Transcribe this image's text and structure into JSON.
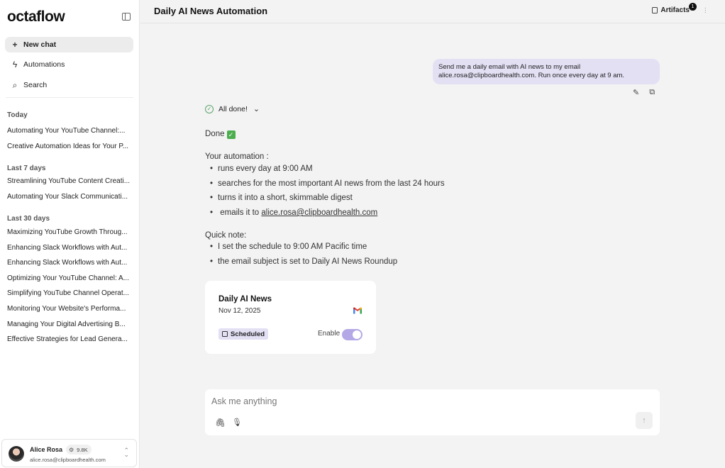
{
  "sidebar": {
    "logo": "octaflow",
    "new_chat": "New chat",
    "automations": "Automations",
    "search": "Search",
    "sections": [
      {
        "label": "Today",
        "items": [
          "Automating Your YouTube Channel:...",
          "Creative Automation Ideas for Your P..."
        ]
      },
      {
        "label": "Last 7 days",
        "items": [
          "Streamlining YouTube Content Creati...",
          "Automating Your Slack Communicati..."
        ]
      },
      {
        "label": "Last 30 days",
        "items": [
          "Maximizing YouTube Growth Throug...",
          "Enhancing Slack Workflows with Aut...",
          "Enhancing Slack Workflows with Aut...",
          "Optimizing Your YouTube Channel: A...",
          "Simplifying YouTube Channel Operat...",
          "Monitoring Your Website's Performa...",
          "Managing Your Digital Advertising B...",
          "Effective Strategies for Lead Genera..."
        ]
      }
    ],
    "user": {
      "name": "Alice Rosa",
      "email": "alice.rosa@clipboardhealth.com",
      "credits": "9.8K"
    }
  },
  "header": {
    "title": "Daily AI News Automation",
    "artifacts_label": "Artifacts",
    "artifacts_count": "1"
  },
  "chat": {
    "user_message_line1": "Send me a daily email with AI news to my email",
    "user_message_line2": "alice.rosa@clipboardhealth.com. Run once every day at 9 am.",
    "status": "All done!",
    "done_text": "Done",
    "automation_heading": "Your automation :",
    "automation_bullets": [
      "runs every day at 9:00 AM",
      "searches for the most important AI news from the last 24 hours",
      "turns it into a short, skimmable digest"
    ],
    "email_bullet_prefix": "emails it to ",
    "email_bullet_address": "alice.rosa@clipboardhealth.com",
    "note_heading": "Quick note:",
    "note_bullets": [
      "I set the schedule to 9:00 AM Pacific time",
      "the email subject is set to Daily AI News Roundup"
    ]
  },
  "card": {
    "title": "Daily AI News",
    "date": "Nov 12, 2025",
    "status": "Scheduled",
    "enable_label": "Enable",
    "enabled": true
  },
  "composer": {
    "placeholder": "Ask me anything"
  },
  "colors": {
    "accent": "#b4a8e6",
    "bubble": "#e3e0f4"
  },
  "icons": [
    "plus-icon",
    "lightning-icon",
    "search-icon",
    "sidebar-collapse-icon",
    "copy-icon",
    "kebab-icon",
    "pencil-icon",
    "check-circle-icon",
    "chevron-down-icon",
    "gmail-icon",
    "calendar-icon",
    "paperclip-icon",
    "microphone-icon",
    "arrow-up-icon"
  ]
}
